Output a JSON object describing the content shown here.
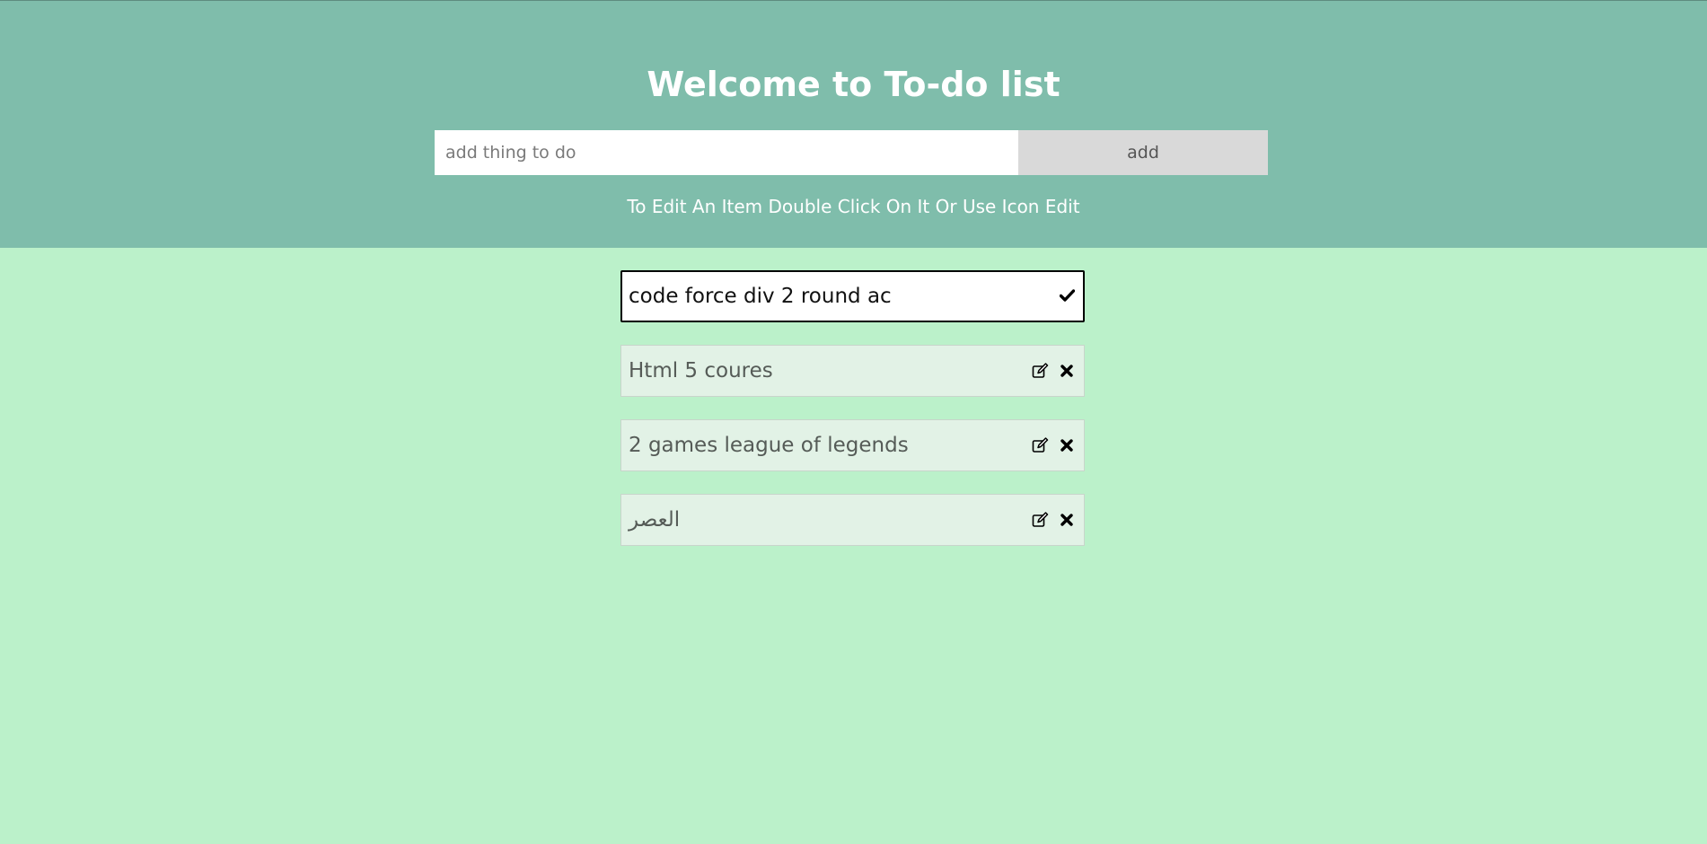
{
  "header": {
    "title": "Welcome to To-do list",
    "add_placeholder": "add thing to do",
    "add_input_value": "",
    "add_button_label": "add",
    "hint": "To Edit An Item Double Click On It Or Use Icon Edit"
  },
  "todos": {
    "editing": {
      "value": "code force div 2 round ac",
      "icons": [
        "check-icon"
      ]
    },
    "items": [
      {
        "text": "Html 5 coures",
        "icons": [
          "edit-icon",
          "close-icon"
        ]
      },
      {
        "text": "2 games league of legends",
        "icons": [
          "edit-icon",
          "close-icon"
        ]
      },
      {
        "text": "العصر",
        "icons": [
          "edit-icon",
          "close-icon"
        ]
      }
    ]
  },
  "colors": {
    "header_bg": "#7fbdab",
    "page_bg": "#bbf1ca",
    "item_bg": "#e2f2e6",
    "button_bg": "#d9d9d9"
  }
}
